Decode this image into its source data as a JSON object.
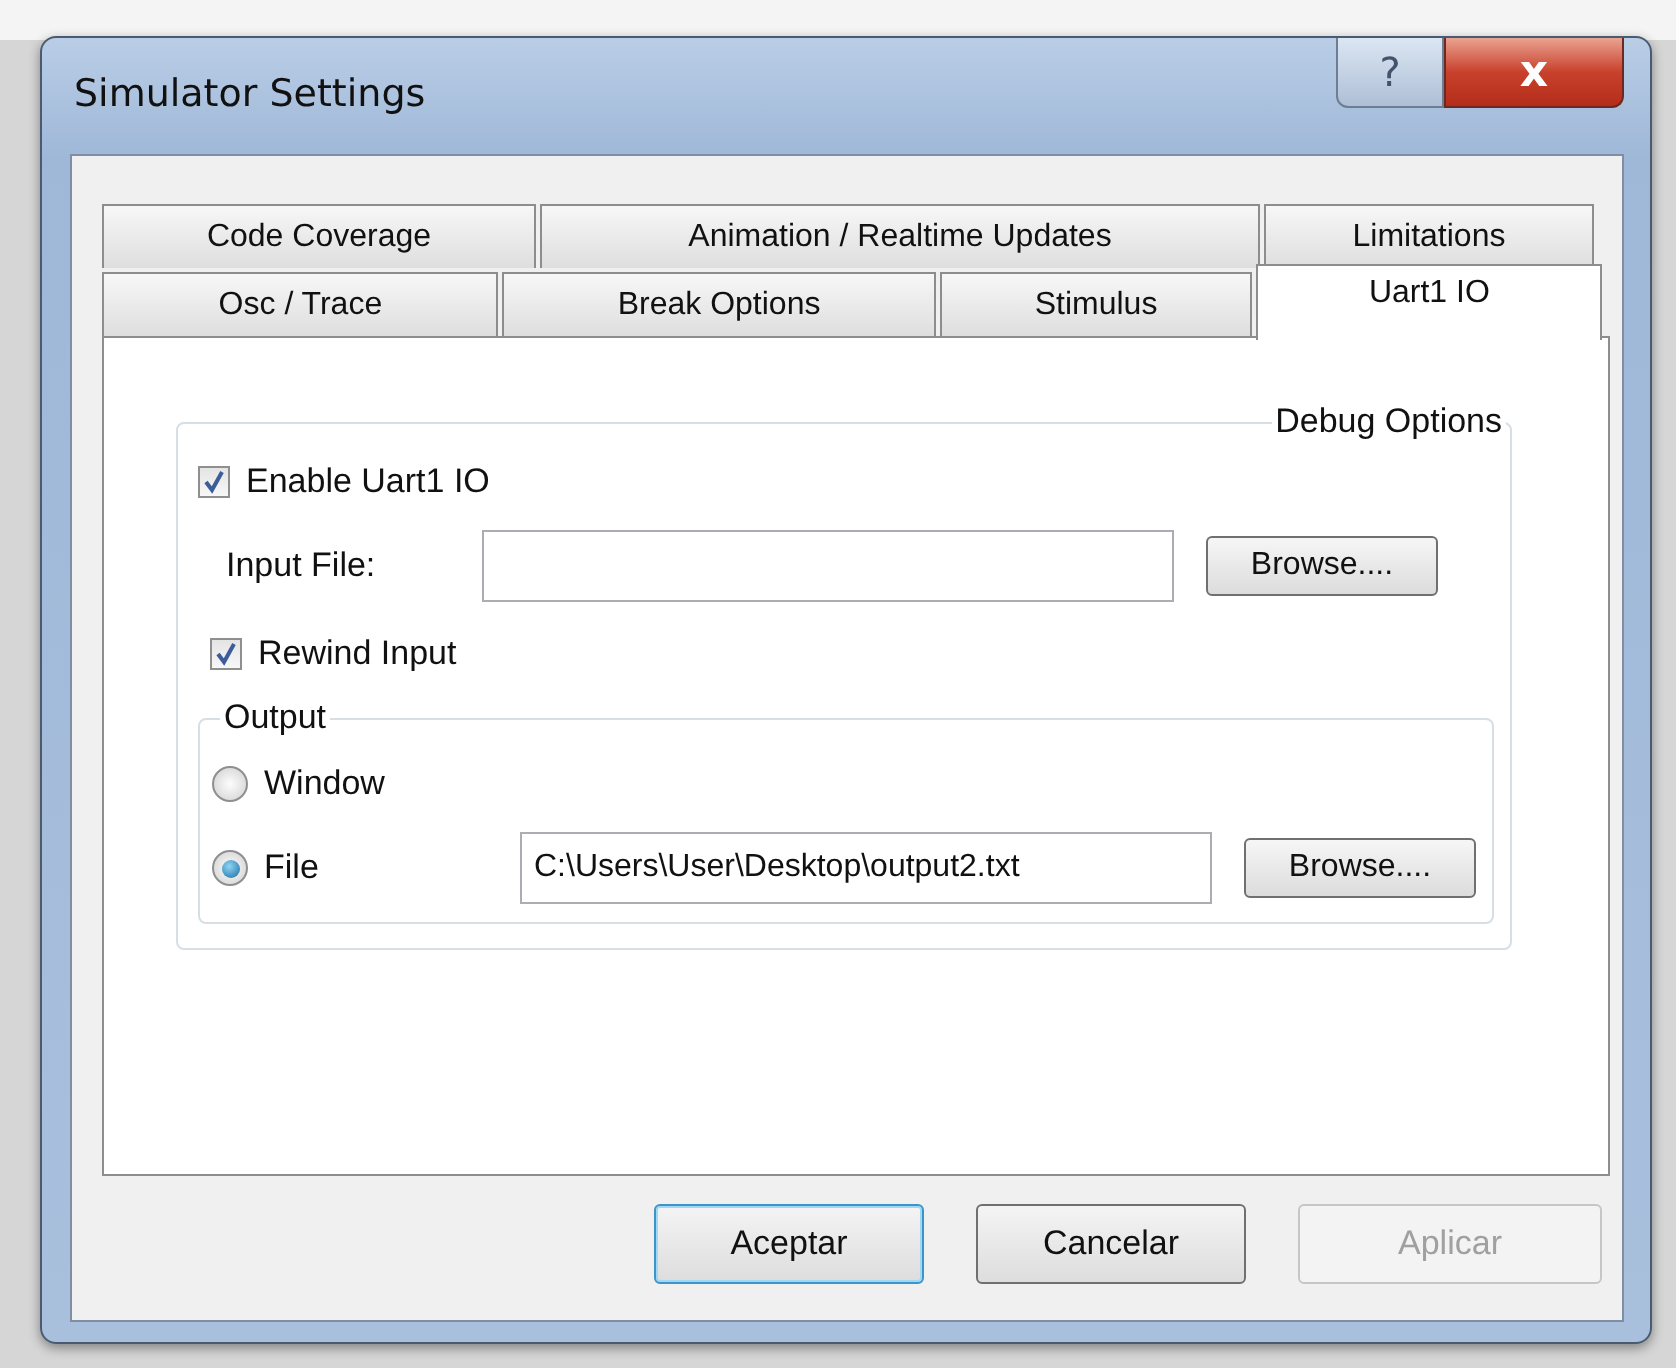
{
  "window": {
    "title": "Simulator Settings",
    "help_button": "?",
    "close_button": "x"
  },
  "tab_rows": [
    [
      {
        "label": "Code Coverage",
        "selected": false
      },
      {
        "label": "Animation / Realtime  Updates",
        "selected": false
      },
      {
        "label": "Limitations",
        "selected": false
      }
    ],
    [
      {
        "label": "Osc / Trace",
        "selected": false
      },
      {
        "label": "Break Options",
        "selected": false
      },
      {
        "label": "Stimulus",
        "selected": false
      },
      {
        "label": "Uart1  IO",
        "selected": true
      }
    ]
  ],
  "debug_options": {
    "legend": "Debug Options",
    "enable": {
      "label": "Enable Uart1 IO",
      "checked": true
    },
    "input_file": {
      "label": "Input  File:",
      "browse": "Browse...."
    },
    "rewind": {
      "label": "Rewind Input",
      "checked": true
    },
    "output": {
      "legend": "Output",
      "options": [
        {
          "label": "Window",
          "selected": false
        },
        {
          "label": "File",
          "selected": true
        }
      ],
      "file_value": "C:\\Users\\User\\Desktop\\output2.txt",
      "browse": "Browse...."
    }
  },
  "buttons": [
    {
      "label": "Aceptar",
      "disabled": false,
      "default": true
    },
    {
      "label": "Cancelar",
      "disabled": false,
      "default": false
    },
    {
      "label": "Aplicar",
      "disabled": true,
      "default": false
    }
  ]
}
